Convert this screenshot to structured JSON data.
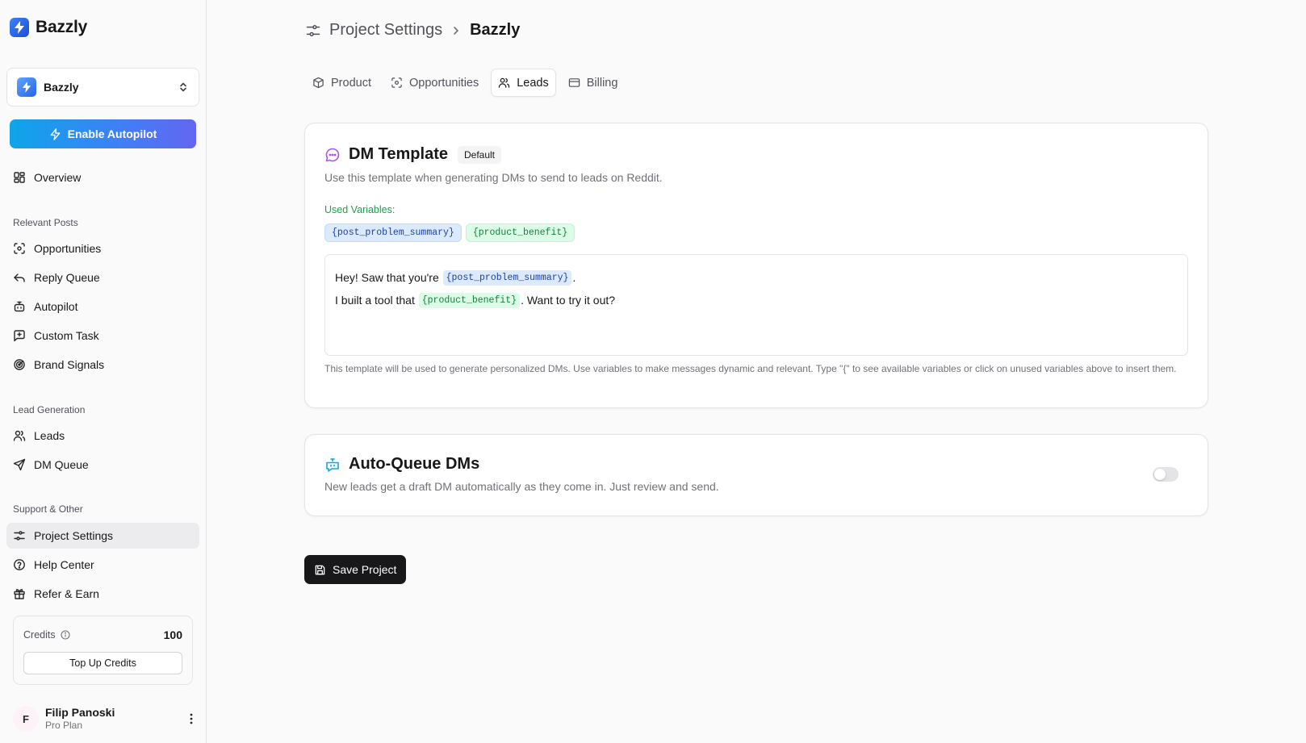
{
  "app": {
    "name": "Bazzly"
  },
  "sidebar": {
    "project": {
      "name": "Bazzly"
    },
    "autopilot_button": "Enable Autopilot",
    "overview": {
      "label": "Overview",
      "icon": "layout-grid-icon"
    },
    "sections": [
      {
        "label": "Relevant Posts",
        "items": [
          {
            "label": "Opportunities",
            "icon": "scan-eye-icon"
          },
          {
            "label": "Reply Queue",
            "icon": "reply-icon"
          },
          {
            "label": "Autopilot",
            "icon": "bot-icon"
          },
          {
            "label": "Custom Task",
            "icon": "message-square-plus-icon"
          },
          {
            "label": "Brand Signals",
            "icon": "radar-icon"
          }
        ]
      },
      {
        "label": "Lead Generation",
        "items": [
          {
            "label": "Leads",
            "icon": "users-icon"
          },
          {
            "label": "DM Queue",
            "icon": "send-icon"
          }
        ]
      },
      {
        "label": "Support & Other",
        "items": [
          {
            "label": "Project Settings",
            "icon": "settings-sliders-icon",
            "active": true
          },
          {
            "label": "Help Center",
            "icon": "help-circle-icon"
          },
          {
            "label": "Refer & Earn",
            "icon": "gift-icon"
          }
        ]
      }
    ],
    "credits": {
      "label": "Credits",
      "value": "100",
      "topup_label": "Top Up Credits"
    },
    "user": {
      "initial": "F",
      "name": "Filip Panoski",
      "plan": "Pro Plan"
    }
  },
  "header": {
    "parent": "Project Settings",
    "current": "Bazzly"
  },
  "tabs": [
    {
      "label": "Product",
      "icon": "package-icon"
    },
    {
      "label": "Opportunities",
      "icon": "scan-eye-icon"
    },
    {
      "label": "Leads",
      "icon": "users-icon",
      "active": true
    },
    {
      "label": "Billing",
      "icon": "credit-card-icon"
    }
  ],
  "dm_template": {
    "title": "DM Template",
    "badge": "Default",
    "description": "Use this template when generating DMs to send to leads on Reddit.",
    "used_variables_label": "Used Variables:",
    "variables": [
      "{post_problem_summary}",
      "{product_benefit}"
    ],
    "line1": {
      "before": "Hey! Saw that you're ",
      "var": "{post_problem_summary}",
      "after": "."
    },
    "line2": {
      "before": "I built a tool that ",
      "var": "{product_benefit}",
      "after": ". Want to try it out?"
    },
    "hint": "This template will be used to generate personalized DMs. Use variables to make messages dynamic and relevant. Type \"{\" to see available variables or click on unused variables above to insert them."
  },
  "auto_queue": {
    "title": "Auto-Queue DMs",
    "description": "New leads get a draft DM automatically as they come in. Just review and send.",
    "enabled": false
  },
  "save_button": "Save Project",
  "colors": {
    "accent": "#3b82f6",
    "primary_button": "#18181b",
    "variable_blue": "#dbeafe",
    "variable_green": "#dcfce7"
  }
}
